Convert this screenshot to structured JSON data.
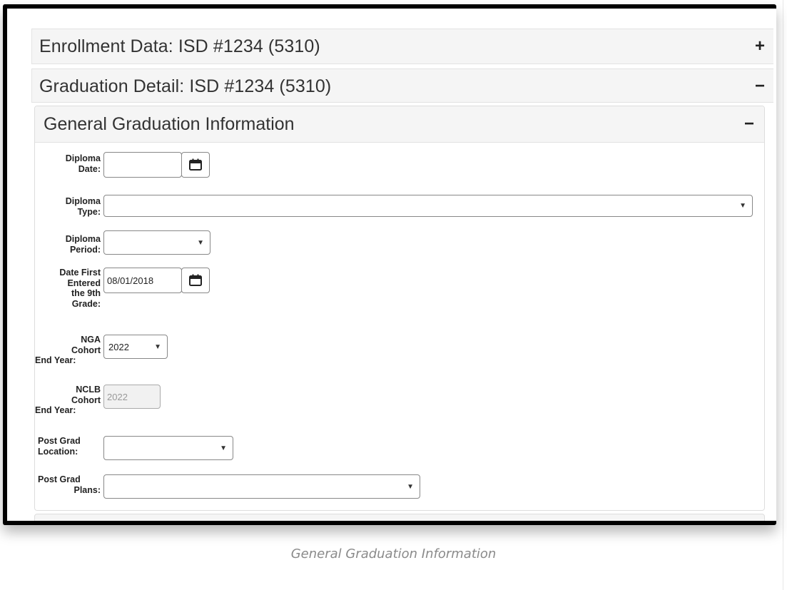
{
  "panels": {
    "enrollment": {
      "title": "Enrollment Data: ISD #1234 (5310)",
      "toggle": "+"
    },
    "graduation": {
      "title": "Graduation Detail: ISD #1234 (5310)",
      "toggle": "−"
    }
  },
  "section": {
    "title": "General Graduation Information",
    "toggle": "−"
  },
  "fields": {
    "diploma_date": {
      "label_1": "Diploma",
      "label_2": "Date:",
      "value": ""
    },
    "diploma_type": {
      "label_1": "Diploma",
      "label_2": "Type:",
      "value": ""
    },
    "diploma_period": {
      "label_1": "Diploma",
      "label_2": "Period:",
      "value": ""
    },
    "date_first_9th": {
      "label_1": "Date First",
      "label_2": "Entered",
      "label_3": "the 9th",
      "label_4": "Grade:",
      "value": "08/01/2018"
    },
    "nga_cohort": {
      "label_1": "NGA",
      "label_2": "Cohort",
      "label_3": "End Year:",
      "value": "2022"
    },
    "nclb_cohort": {
      "label_1": "NCLB",
      "label_2": "Cohort",
      "label_3": "End Year:",
      "value": "2022"
    },
    "post_grad_location": {
      "label_1": "Post Grad",
      "label_2": "Location:",
      "value": ""
    },
    "post_grad_plans": {
      "label_1": "Post Grad",
      "label_2": "Plans:",
      "value": ""
    }
  },
  "icons": {
    "calendar": "calendar-icon",
    "dropdown": "dropdown-caret-icon"
  },
  "caption": "General Graduation Information"
}
